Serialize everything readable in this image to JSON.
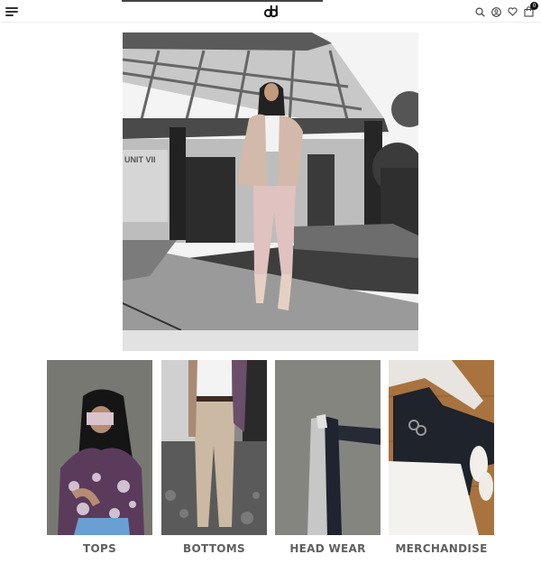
{
  "header": {
    "menu_icon": "hamburger-menu-icon",
    "logo_icon": "brand-logo-icon",
    "icons": [
      "search-icon",
      "account-icon",
      "heart-icon",
      "bag-icon"
    ],
    "cart_count": "0"
  },
  "hero": {
    "signage_text": "UNIT VII"
  },
  "categories": [
    {
      "label": "TOPS"
    },
    {
      "label": "BOTTOMS"
    },
    {
      "label": "HEAD WEAR"
    },
    {
      "label": "MERCHANDISE"
    }
  ]
}
